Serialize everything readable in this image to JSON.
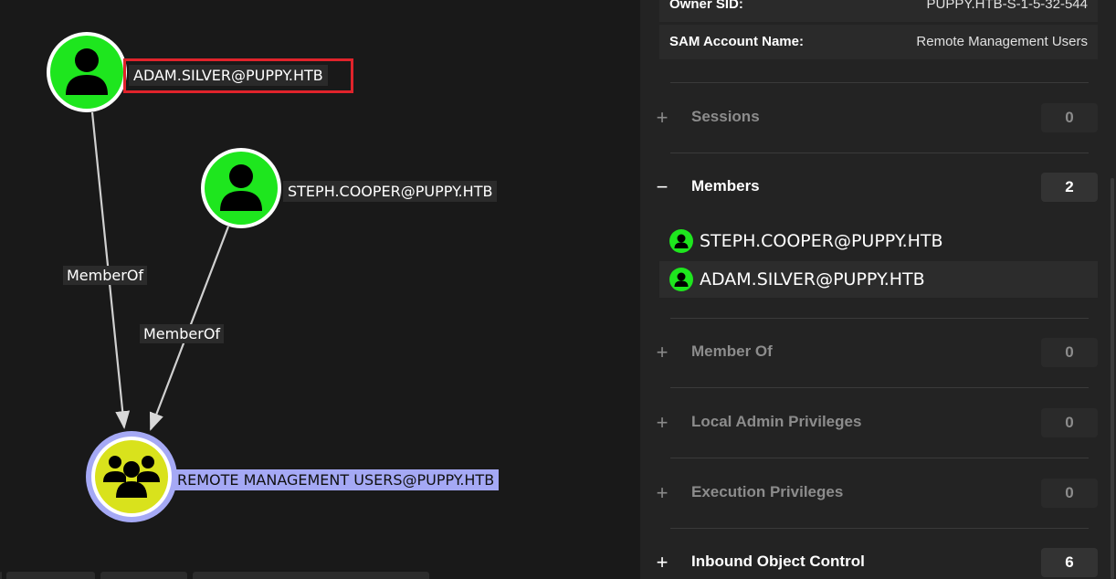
{
  "graph": {
    "nodes": [
      {
        "id": "adam",
        "label": "ADAM.SILVER@PUPPY.HTB",
        "type": "user",
        "icon": "user-icon",
        "color": "#1ee61e"
      },
      {
        "id": "steph",
        "label": "STEPH.COOPER@PUPPY.HTB",
        "type": "user",
        "icon": "user-icon",
        "color": "#1ee61e"
      },
      {
        "id": "rmu",
        "label": "REMOTE MANAGEMENT USERS@PUPPY.HTB",
        "type": "group",
        "icon": "group-icon",
        "color": "#d9e21c",
        "selected": true
      }
    ],
    "edges": [
      {
        "from": "adam",
        "to": "rmu",
        "label": "MemberOf"
      },
      {
        "from": "steph",
        "to": "rmu",
        "label": "MemberOf"
      }
    ],
    "highlight_color": "#e0232b",
    "selection_color": "#a5a9f5"
  },
  "panel": {
    "properties": [
      {
        "key": "Owner SID:",
        "value": "PUPPY.HTB-S-1-5-32-544"
      },
      {
        "key": "SAM Account Name:",
        "value": "Remote Management Users"
      }
    ],
    "sections": [
      {
        "icon": "plus",
        "symbol": "+",
        "title": "Sessions",
        "count": "0"
      },
      {
        "icon": "minus",
        "symbol": "−",
        "title": "Members",
        "count": "2",
        "expanded": true
      },
      {
        "icon": "plus",
        "symbol": "+",
        "title": "Member Of",
        "count": "0"
      },
      {
        "icon": "plus",
        "symbol": "+",
        "title": "Local Admin Privileges",
        "count": "0"
      },
      {
        "icon": "plus",
        "symbol": "+",
        "title": "Execution Privileges",
        "count": "0"
      },
      {
        "icon": "plus",
        "symbol": "+",
        "title": "Inbound Object Control",
        "count": "6"
      }
    ],
    "members": [
      {
        "name": "STEPH.COOPER@PUPPY.HTB",
        "icon": "user-icon"
      },
      {
        "name": "ADAM.SILVER@PUPPY.HTB",
        "icon": "user-icon"
      }
    ]
  }
}
